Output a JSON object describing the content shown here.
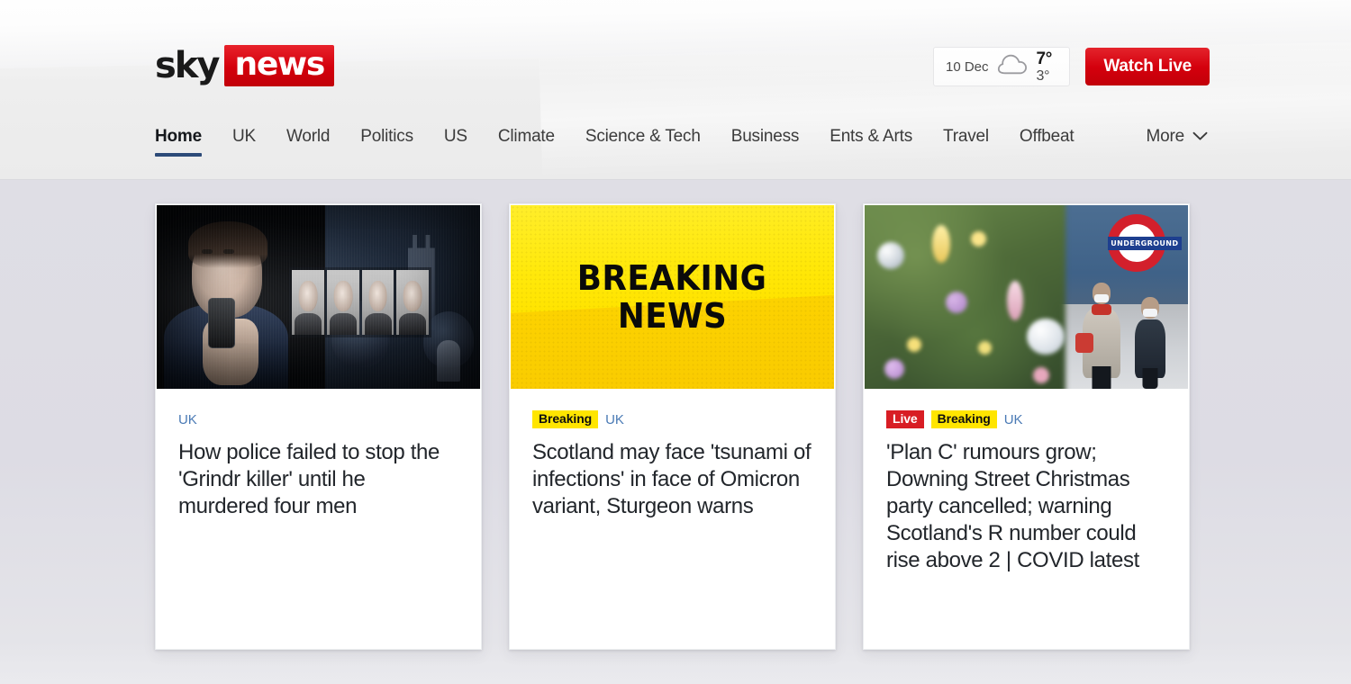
{
  "brand": {
    "logo_sky": "sky",
    "logo_news": "news"
  },
  "header": {
    "weather": {
      "date": "10 Dec",
      "icon": "cloud-icon",
      "high": "7°",
      "low": "3°"
    },
    "watch_live_label": "Watch Live"
  },
  "nav": {
    "items": [
      {
        "label": "Home",
        "active": true
      },
      {
        "label": "UK",
        "active": false
      },
      {
        "label": "World",
        "active": false
      },
      {
        "label": "Politics",
        "active": false
      },
      {
        "label": "US",
        "active": false
      },
      {
        "label": "Climate",
        "active": false
      },
      {
        "label": "Science & Tech",
        "active": false
      },
      {
        "label": "Business",
        "active": false
      },
      {
        "label": "Ents & Arts",
        "active": false
      },
      {
        "label": "Travel",
        "active": false
      },
      {
        "label": "Offbeat",
        "active": false
      }
    ],
    "more_label": "More",
    "more_icon": "chevron-down-icon"
  },
  "cards": [
    {
      "tags": {
        "live": null,
        "breaking": null,
        "section": "UK"
      },
      "headline": "How police failed to stop the 'Grindr killer' until he murdered four men",
      "image_alt": "Dark photo collage of a man looking at a phone beside four victim portraits and a churchyard"
    },
    {
      "tags": {
        "live": null,
        "breaking": "Breaking",
        "section": "UK"
      },
      "headline": "Scotland may face 'tsunami of infections' in face of Omicron variant, Sturgeon warns",
      "image_alt": "Yellow Breaking News graphic",
      "image_text_line1": "BREAKING",
      "image_text_line2": "NEWS"
    },
    {
      "tags": {
        "live": "Live",
        "breaking": "Breaking",
        "section": "UK"
      },
      "headline": "'Plan C' rumours grow; Downing Street Christmas party cancelled; warning Scotland's R number could rise above 2 | COVID latest",
      "image_alt": "Blurred Christmas tree with masked pedestrians near a London Underground sign",
      "image_sign_text": "UNDERGROUND"
    }
  ],
  "colors": {
    "brand_red": "#d4000d",
    "breaking_yellow": "#ffe500",
    "live_red": "#d81d24",
    "section_blue": "#4a7ab5",
    "active_nav_underline": "#2c4a78",
    "page_background": "#dddce4"
  }
}
